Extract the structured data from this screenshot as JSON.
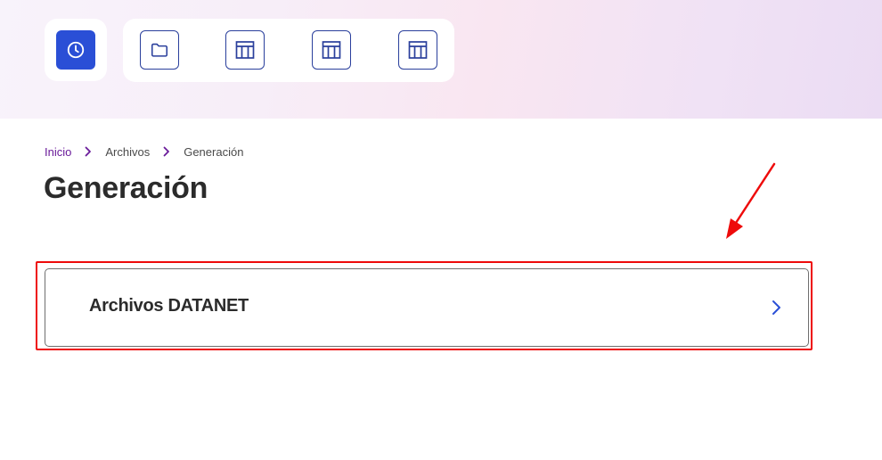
{
  "quick_access": {
    "active": {
      "icon": "clock-icon"
    },
    "items": [
      {
        "icon": "folder-icon"
      },
      {
        "icon": "table-icon"
      },
      {
        "icon": "table-icon"
      },
      {
        "icon": "table-icon"
      }
    ]
  },
  "breadcrumb": {
    "items": [
      "Inicio",
      "Archivos",
      "Generación"
    ]
  },
  "page": {
    "title": "Generación"
  },
  "options": [
    {
      "label": "Archivos DATANET",
      "icon": "chevron-right-icon"
    }
  ],
  "annotation": {
    "highlight_color": "#ee0b0b",
    "arrow_color": "#ee0b0b"
  },
  "colors": {
    "accent": "#2a4fd6",
    "breadcrumb_link": "#6a1b9a",
    "text": "#2b2b2b"
  }
}
